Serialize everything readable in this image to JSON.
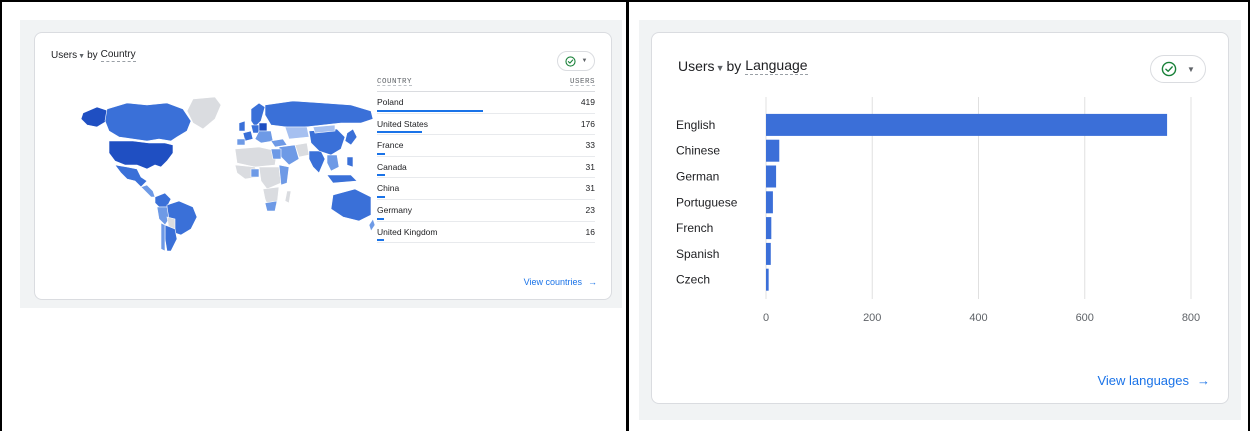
{
  "left_card": {
    "title_metric": "Users",
    "title_by": "by",
    "title_dimension": "Country",
    "columns": {
      "name": "COUNTRY",
      "value": "USERS"
    },
    "rows": [
      {
        "name": "Poland",
        "value": "419",
        "fraction": 1.0
      },
      {
        "name": "United States",
        "value": "176",
        "fraction": 0.42
      },
      {
        "name": "France",
        "value": "33",
        "fraction": 0.079
      },
      {
        "name": "Canada",
        "value": "31",
        "fraction": 0.074
      },
      {
        "name": "China",
        "value": "31",
        "fraction": 0.074
      },
      {
        "name": "Germany",
        "value": "23",
        "fraction": 0.055
      },
      {
        "name": "United Kingdom",
        "value": "16",
        "fraction": 0.038
      }
    ],
    "view_link": "View countries",
    "map_colors": {
      "dark": "#1f4fc2",
      "mid": "#3a70d8",
      "light": "#6e9ae6",
      "pale": "#a6c0f0",
      "none": "#dadce0"
    }
  },
  "right_card": {
    "title_metric": "Users",
    "title_by": "by",
    "title_dimension": "Language",
    "view_link": "View languages",
    "chart_data": {
      "type": "bar",
      "orientation": "horizontal",
      "categories": [
        "English",
        "Chinese",
        "German",
        "Portuguese",
        "French",
        "Spanish",
        "Czech"
      ],
      "values": [
        755,
        25,
        19,
        13,
        10,
        9,
        5
      ],
      "xlim": [
        0,
        800
      ],
      "xticks": [
        "0",
        "200",
        "400",
        "600",
        "800"
      ],
      "grid": true,
      "color": "#3b6fd8"
    }
  },
  "colors": {
    "accent": "#1a73e8",
    "success": "#188038"
  }
}
